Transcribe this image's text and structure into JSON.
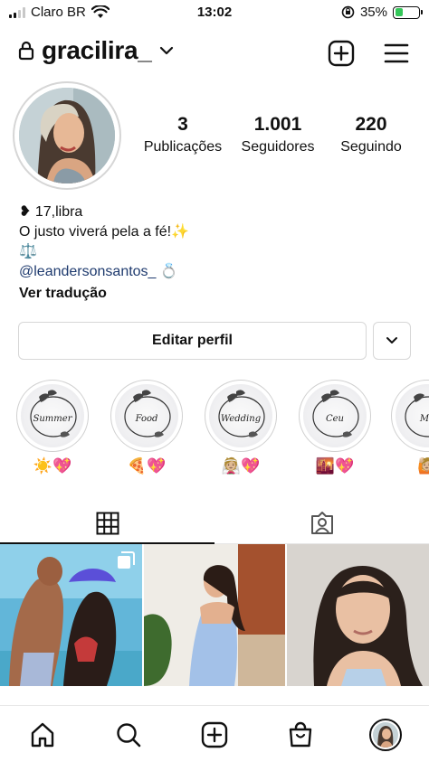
{
  "status_bar": {
    "carrier": "Claro BR",
    "time": "13:02",
    "battery_percent": "35%",
    "battery_level": 0.35
  },
  "header": {
    "username": "gracilira_",
    "icons": [
      "lock-icon",
      "chevron-down-icon",
      "add-post-icon",
      "menu-icon"
    ]
  },
  "profile": {
    "stats": [
      {
        "value": "3",
        "label": "Publicações"
      },
      {
        "value": "1.001",
        "label": "Seguidores"
      },
      {
        "value": "220",
        "label": "Seguindo"
      }
    ],
    "bio": {
      "line1": "❥ 17,libra",
      "line2": "O justo viverá pela a fé!✨",
      "line3": "⚖️",
      "mention": "@leandersonsantos_",
      "mention_emoji": "💍",
      "translate": "Ver tradução"
    },
    "edit_button": "Editar perfil"
  },
  "highlights": [
    {
      "title": "Summer",
      "emoji": "☀️💖"
    },
    {
      "title": "Food",
      "emoji": "🍕💖"
    },
    {
      "title": "Wedding",
      "emoji": "👰🏼💖"
    },
    {
      "title": "Ceu",
      "emoji": "🌇💖"
    },
    {
      "title": "Ma",
      "emoji": "🙋🏼"
    }
  ],
  "tabs": [
    "grid-icon",
    "tagged-icon"
  ],
  "bottom_nav": [
    "home-icon",
    "search-icon",
    "create-icon",
    "shop-icon",
    "profile-avatar"
  ]
}
